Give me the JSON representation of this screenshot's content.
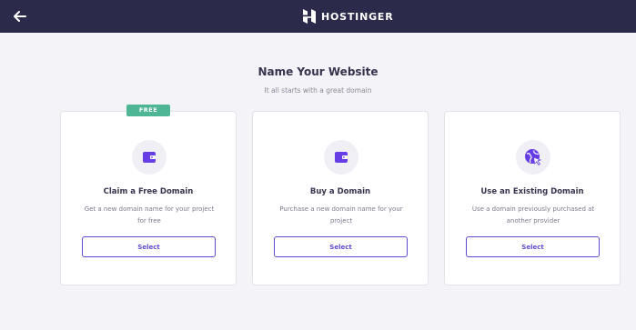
{
  "header": {
    "brand_name": "HOSTINGER",
    "back_icon": "arrow-left-icon",
    "background_color": "#2b2a4a"
  },
  "main": {
    "title": "Name Your Website",
    "subtitle": "It all starts with a great domain"
  },
  "cards": [
    {
      "badge": "FREE",
      "icon": "wallet-icon",
      "title": "Claim a Free Domain",
      "description": "Get a new domain name for your project for free",
      "button_label": "Select"
    },
    {
      "icon": "wallet-icon",
      "title": "Buy a Domain",
      "description": "Purchase a new domain name for your project",
      "button_label": "Select"
    },
    {
      "icon": "globe-cursor-icon",
      "title": "Use an Existing Domain",
      "description": "Use a domain previously purchased at another provider",
      "button_label": "Select"
    }
  ],
  "colors": {
    "accent": "#673de6",
    "badge": "#4fb695",
    "background": "#f4f4f8"
  }
}
